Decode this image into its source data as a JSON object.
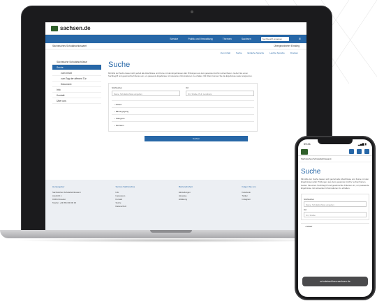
{
  "laptop": {
    "logo": "sachsen.de",
    "nav": [
      "Service",
      "Politik und Verwaltung",
      "Themen",
      "Sachsen"
    ],
    "search_placeholder": "Suchbegriff eingeben",
    "breadcrumb": "Sächsisches Schulabschlussamt",
    "language": "Übergeordneter Einstieg",
    "tools": [
      "Zum Inhalt",
      "Suche",
      "Einfache Sprache",
      "Leichte Sprache",
      "Drucken"
    ],
    "sidebar": [
      {
        "label": "Sächsische Schulabschlüsse",
        "active": false,
        "sub": false
      },
      {
        "label": "Suche",
        "active": true,
        "sub": false
      },
      {
        "label": "zum Inhalt",
        "active": false,
        "sub": true
      },
      {
        "label": "zum Tag der offenen Tür",
        "active": false,
        "sub": true
      },
      {
        "label": "Dokument",
        "active": false,
        "sub": true
      },
      {
        "label": "Info",
        "active": false,
        "sub": false
      },
      {
        "label": "Kontakt",
        "active": false,
        "sub": false
      },
      {
        "label": "Über uns",
        "active": false,
        "sub": false
      }
    ],
    "title": "Suche",
    "intro": "Mit Hilfe der Suche lassen sich gezielt alle Abschlüsse und Kurse mit den Ergebnissen aller Prüfungen aus dem gesamten Archiv recherchieren. Geben Sie einen Suchbegriff und gewünschte Kriterien ein, um passende Ergebnisse mit relevanten Informationen zu erhalten. Mit Filtern können Sie die Ergebnisse weiter eingrenzen.",
    "form": {
      "label_left": "Stichwörter",
      "placeholder_left": "Name, Schulabschluss eingeben",
      "label_right": "Ort",
      "placeholder_right": "Ort, Straße, PLZ, Landkreis",
      "accordions": [
        "Ablauf",
        "Bildungsgang",
        "Kategorie",
        "Zeitraum"
      ],
      "submit": "Suchen"
    },
    "footer": {
      "col1_title": "Herausgeber",
      "col1_lines": [
        "Sächsisches Schulabschlussamt",
        "Anschrift 1",
        "01001 Dresden",
        "Telefon: +49 351 000 00 00"
      ],
      "col2_title": "Service Sächsisches",
      "col2_lines": [
        "Info",
        "Impressum",
        "Kontakt",
        "Suche",
        "Datenschutz"
      ],
      "col3_title": "Barrierefreiheit",
      "col3_lines": [
        "Einstellungen",
        "Hinweise",
        "Erklärung"
      ],
      "col4_title": "Folgen Sie uns",
      "col4_lines": [
        "Facebook",
        "Twitter",
        "Instagram"
      ]
    }
  },
  "phone": {
    "time": "09:41",
    "breadcrumb": "Sächsisches Schulabschlussamt",
    "title": "Suche",
    "intro": "Mit Hilfe der Suche lassen sich gezielt alle Abschlüsse und Kurse mit den Ergebnissen aller Prüfungen aus dem gesamten Archiv recherchieren. Geben Sie einen Suchbegriff und gewünschte Kriterien ein, um passende Ergebnisse mit relevanten Informationen zu erhalten.",
    "label_left": "Stichwörter",
    "placeholder_left": "Name, Schulabschluss eingeben",
    "label_right": "Ort",
    "placeholder_right": "Ort, Straße",
    "accordion": "Ablauf",
    "url": "schulabschluss.sachsen.de"
  },
  "colors": {
    "brand_blue": "#2767a7",
    "footer_bg": "#eceff3"
  }
}
